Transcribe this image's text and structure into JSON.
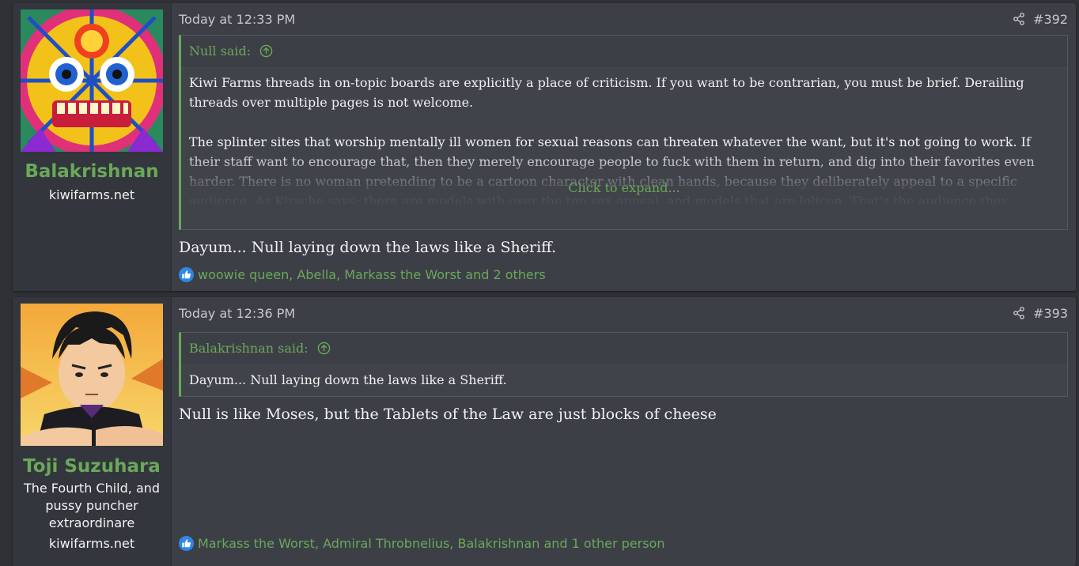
{
  "posts": [
    {
      "username": "Balakrishnan",
      "usersite": "kiwifarms.net",
      "date": "Today at 12:33 PM",
      "number": "#392",
      "quote": {
        "author_label": "Null said:",
        "paragraphs": [
          "Kiwi Farms threads in on-topic boards are explicitly a place of criticism. If you want to be contrarian, you must be brief. Derailing threads over multiple pages is not welcome.",
          "The splinter sites that worship mentally ill women for sexual reasons can threaten whatever the want, but it's not going to work. If their staff want to encourage that, then they merely encourage people to fuck with them in return, and dig into their favorites even harder. There is no woman pretending to be a cartoon character with clean hands, because they deliberately appeal to a specific audience. As Kirsche says: there are models with over the top sex appeal, and models that are lolicon. That's the audience they cultivate."
        ],
        "expand_label": "Click to expand..."
      },
      "message": "Dayum... Null laying down the laws like a Sheriff.",
      "reactions": "woowie queen, Abella, Markass the Worst and 2 others"
    },
    {
      "username": "Toji Suzuhara",
      "usertitle": "The Fourth Child, and pussy puncher extraordinare",
      "usersite": "kiwifarms.net",
      "date": "Today at 12:36 PM",
      "number": "#393",
      "quote": {
        "author_label": "Balakrishnan said:",
        "paragraphs": [
          "Dayum... Null laying down the laws like a Sheriff."
        ]
      },
      "message": "Null is like Moses, but the Tablets of the Law are just blocks of cheese",
      "reactions": "Markass the Worst, Admiral Throbnelius, Balakrishnan and 1 other person"
    }
  ],
  "colors": {
    "accent": "#6aa85a",
    "post_bg": "#3c3f46",
    "user_bg": "#33363c",
    "page_bg": "#2f3136",
    "like_blue": "#2d88e8"
  },
  "icons": {
    "share": "share-icon",
    "quote_jump": "arrow-up-circle-icon",
    "like": "like-icon"
  }
}
